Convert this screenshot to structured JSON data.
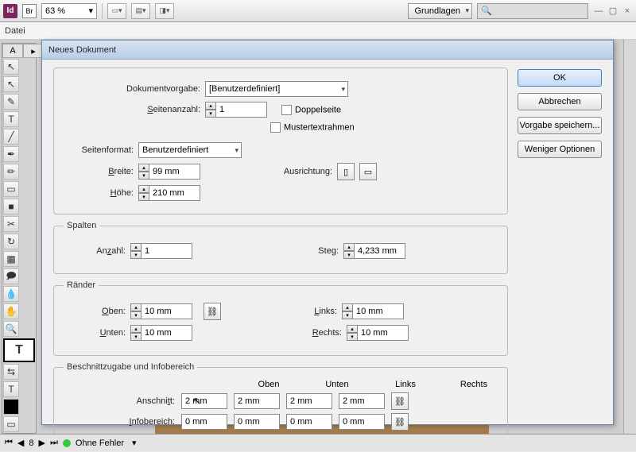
{
  "app": {
    "zoom": "63 %",
    "workspace_label": "Grundlagen"
  },
  "menu": {
    "file": "Datei"
  },
  "dialog": {
    "title": "Neues Dokument",
    "buttons": {
      "ok": "OK",
      "cancel": "Abbrechen",
      "save_preset": "Vorgabe speichern...",
      "fewer_options": "Weniger Optionen"
    },
    "preset": {
      "label": "Dokumentvorgabe:",
      "value": "[Benutzerdefiniert]"
    },
    "pages": {
      "label": "Seitenanzahl:",
      "value": "1"
    },
    "facing": {
      "label": "Doppelseite"
    },
    "master_text": {
      "label": "Mustertextrahmen"
    },
    "page_size": {
      "label": "Seitenformat:",
      "value": "Benutzerdefiniert",
      "width_label": "Breite:",
      "width": "99 mm",
      "height_label": "Höhe:",
      "height": "210 mm",
      "orientation_label": "Ausrichtung:"
    },
    "columns": {
      "legend": "Spalten",
      "count_label": "Anzahl:",
      "count": "1",
      "gutter_label": "Steg:",
      "gutter": "4,233 mm"
    },
    "margins": {
      "legend": "Ränder",
      "top_label": "Oben:",
      "top": "10 mm",
      "bottom_label": "Unten:",
      "bottom": "10 mm",
      "left_label": "Links:",
      "left": "10 mm",
      "right_label": "Rechts:",
      "right": "10 mm"
    },
    "bleed": {
      "legend": "Beschnittzugabe und Infobereich",
      "hdr": [
        "Oben",
        "Unten",
        "Links",
        "Rechts"
      ],
      "bleed_label": "Anschnitt:",
      "bleed": [
        "2 mm",
        "2 mm",
        "2 mm",
        "2 mm"
      ],
      "slug_label": "Infobereich:",
      "slug": [
        "0 mm",
        "0 mm",
        "0 mm",
        "0 mm"
      ]
    }
  },
  "status": {
    "page_num": "8",
    "errors": "Ohne Fehler"
  }
}
